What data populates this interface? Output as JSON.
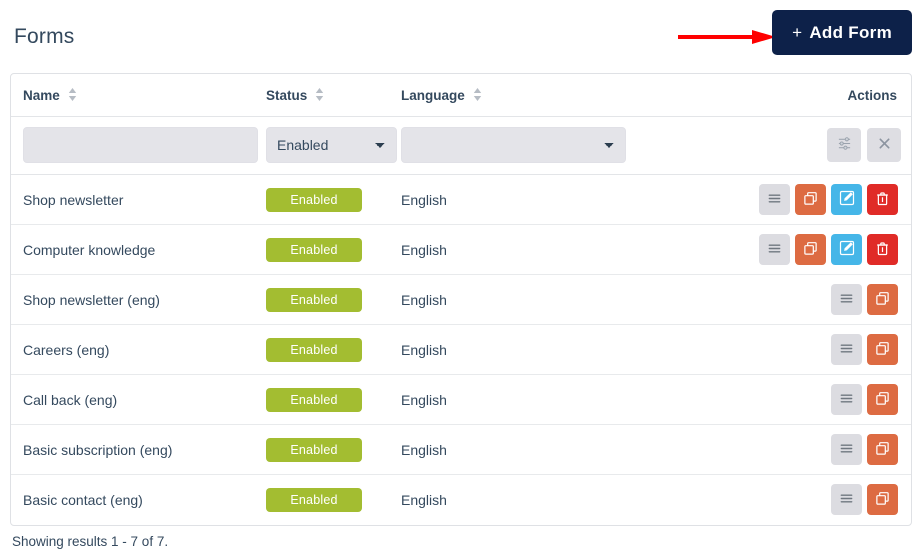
{
  "header": {
    "title": "Forms",
    "add_button_label": "Add Form",
    "add_button_plus": "+",
    "add_button_color": "#0d2149",
    "annotation_arrow_color": "#ff0000"
  },
  "table": {
    "columns": [
      {
        "key": "name",
        "label": "Name",
        "sortable": true
      },
      {
        "key": "status",
        "label": "Status",
        "sortable": true
      },
      {
        "key": "language",
        "label": "Language",
        "sortable": true
      },
      {
        "key": "actions",
        "label": "Actions",
        "sortable": false
      }
    ],
    "filters": {
      "name_value": "",
      "name_placeholder": "",
      "status_selected": "Enabled",
      "status_options": [
        "Enabled"
      ],
      "language_selected": "",
      "language_options": [
        ""
      ],
      "apply_icon": "sliders-filter-icon",
      "clear_icon": "close-x-icon"
    },
    "rows": [
      {
        "name": "Shop newsletter",
        "status": "Enabled",
        "language": "English",
        "actions": [
          "menu-icon",
          "copy-icon",
          "edit-icon",
          "delete-icon"
        ]
      },
      {
        "name": "Computer knowledge",
        "status": "Enabled",
        "language": "English",
        "actions": [
          "menu-icon",
          "copy-icon",
          "edit-icon",
          "delete-icon"
        ]
      },
      {
        "name": "Shop newsletter (eng)",
        "status": "Enabled",
        "language": "English",
        "actions": [
          "menu-icon",
          "copy-icon"
        ]
      },
      {
        "name": "Careers (eng)",
        "status": "Enabled",
        "language": "English",
        "actions": [
          "menu-icon",
          "copy-icon"
        ]
      },
      {
        "name": "Call back (eng)",
        "status": "Enabled",
        "language": "English",
        "actions": [
          "menu-icon",
          "copy-icon"
        ]
      },
      {
        "name": "Basic subscription (eng)",
        "status": "Enabled",
        "language": "English",
        "actions": [
          "menu-icon",
          "copy-icon"
        ]
      },
      {
        "name": "Basic contact (eng)",
        "status": "Enabled",
        "language": "English",
        "actions": [
          "menu-icon",
          "copy-icon"
        ]
      }
    ]
  },
  "footer": {
    "results_text": "Showing results 1 - 7 of 7."
  },
  "colors": {
    "status_badge": "#a3bd31",
    "action_menu": "#dcdce1",
    "action_copy": "#dd6b42",
    "action_edit": "#45b6e8",
    "action_delete": "#e02b27",
    "text": "#34495e"
  }
}
